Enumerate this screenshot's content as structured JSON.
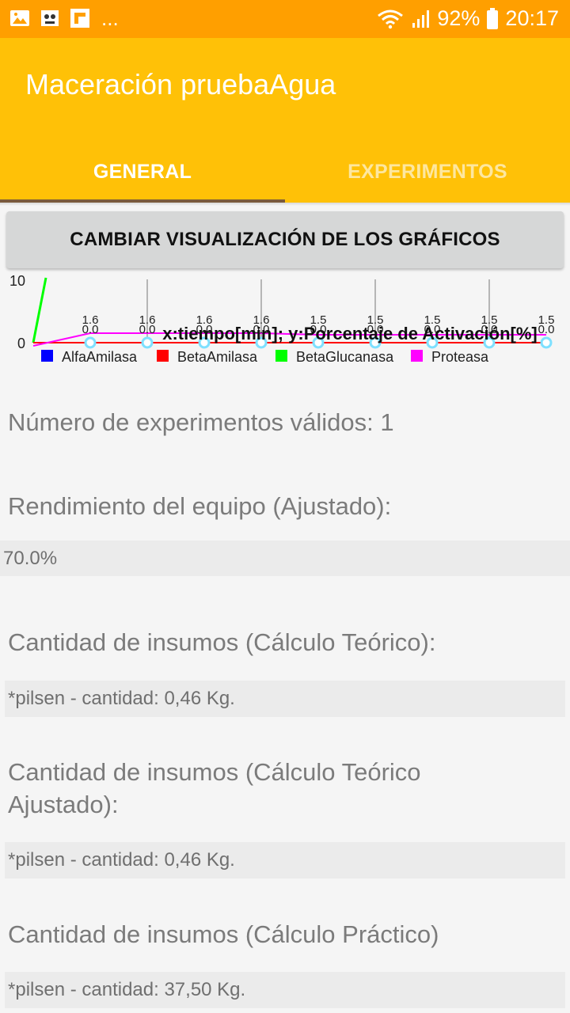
{
  "status_bar": {
    "dots": "...",
    "battery": "92%",
    "time": "20:17"
  },
  "app": {
    "title": "Maceración pruebaAgua"
  },
  "tabs": [
    {
      "label": "GENERAL",
      "active": true
    },
    {
      "label": "EXPERIMENTOS",
      "active": false
    }
  ],
  "button": {
    "label": "CAMBIAR VISUALIZACIÓN DE LOS GRÁFICOS"
  },
  "chart_data": {
    "type": "line",
    "title": "x:tiempo[min]; y:Porcentaje de Activación[%]",
    "y_tick_labels": [
      "0",
      "10"
    ],
    "legend": [
      "AlfaAmilasa",
      "BetaAmilasa",
      "BetaGlucanasa",
      "Proteasa"
    ],
    "colors": {
      "AlfaAmilasa": "#0000ff",
      "BetaAmilasa": "#ff0000",
      "BetaGlucanasa": "#00ff00",
      "Proteasa": "#ff00ff"
    },
    "point_top_labels": [
      "1.6",
      "1.6",
      "1.6",
      "1.6",
      "1.5",
      "1.5",
      "1.5",
      "1.5",
      "1.5"
    ],
    "point_bottom_labels": [
      "0.0",
      "0.0",
      "0.0",
      "0.0",
      "0.0",
      "0.0",
      "0.0",
      "0.0",
      "0.0"
    ]
  },
  "sections": [
    {
      "label": "Número de experimentos válidos: 1"
    },
    {
      "label": "Rendimiento del equipo (Ajustado):",
      "value": "70.0%"
    },
    {
      "label": "Cantidad de insumos (Cálculo Teórico):",
      "value": "*pilsen - cantidad: 0,46 Kg."
    },
    {
      "label": "Cantidad de insumos (Cálculo Teórico Ajustado):",
      "value": "*pilsen - cantidad: 0,46 Kg."
    },
    {
      "label": "Cantidad de insumos (Cálculo Práctico)",
      "value": "*pilsen - cantidad: 37,50 Kg."
    }
  ]
}
